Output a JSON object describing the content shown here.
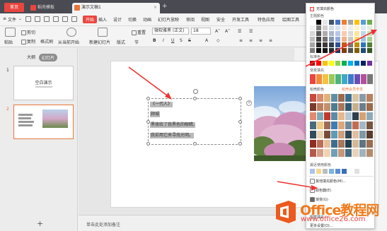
{
  "tabs": {
    "home": "首页",
    "t1": "稻壳模板",
    "t2": "演示文稿1"
  },
  "menu": {
    "file": "文件",
    "kaishi": "开始",
    "items": [
      "插入",
      "设计",
      "切换",
      "动画",
      "幻灯片放映",
      "审阅",
      "视图",
      "安全",
      "开发工具",
      "特色应用",
      "绘图工具",
      "文"
    ]
  },
  "toolbar": {
    "paste": "粘贴",
    "cut": "剪切",
    "copy": "复制",
    "format_painter": "格式刷",
    "from_current": "从当前开始",
    "new_slide": "新建幻灯片",
    "layout": "版式",
    "section": "节",
    "reset": "重置",
    "font": "微软雅黑 (正文)",
    "size": "18"
  },
  "sidebar": {
    "tab_outline": "大纲",
    "tab_slides": "幻灯片",
    "n1": "1",
    "n2": "2",
    "thumb_title": "空白演示",
    "add": "+"
  },
  "slide": {
    "lines": [
      "《一代人》",
      "顾城",
      "黑夜给了我黑色的眼睛,",
      "我却用它来寻找光明。"
    ]
  },
  "notes": {
    "text": "单击此处添加备注"
  },
  "panel": {
    "no_fill": "无填充颜色",
    "theme": "主题颜色",
    "standard": "标准色",
    "gradient": "渐变填充",
    "docer": "稻壳颜色",
    "docer_exclusive": "稻壳会员专享",
    "recent": "最近使用颜色",
    "other": "其他填充颜色(M)...",
    "eyedropper": "取色器(E)",
    "grad_item": "渐变(G)",
    "texture": "图案填充",
    "more": "更多设置(O)..."
  },
  "logo": {
    "text": "Office教程网",
    "url": "www.office26.com"
  }
}
